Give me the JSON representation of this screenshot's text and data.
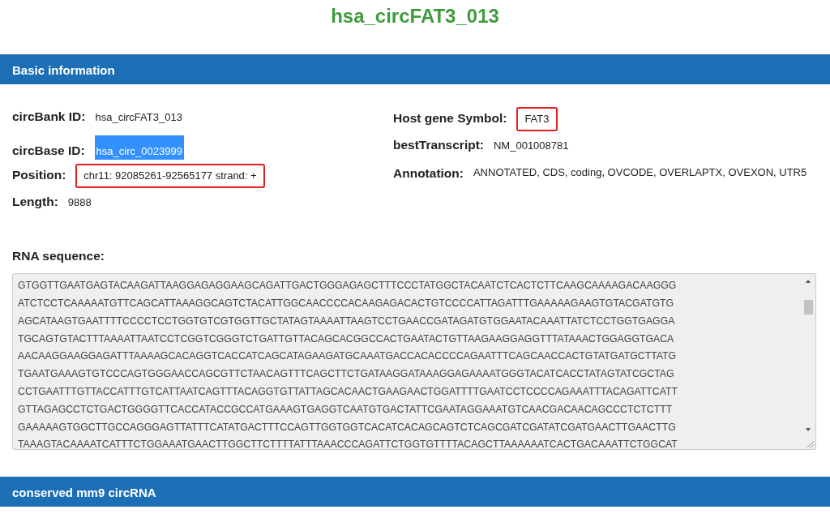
{
  "title": "hsa_circFAT3_013",
  "sections": [
    {
      "heading": "Basic information"
    },
    {
      "heading": "conserved mm9 circRNA"
    }
  ],
  "left_fields": [
    {
      "label": "circBank ID:",
      "value": "hsa_circFAT3_013",
      "highlighted": false,
      "outlined": false
    },
    {
      "label": "circBase ID:",
      "value": "hsa_circ_0023999",
      "highlighted": true,
      "outlined": false
    },
    {
      "label": "Position:",
      "value": "chr11: 92085261-92565177 strand: +",
      "highlighted": false,
      "outlined": true
    },
    {
      "label": "Length:",
      "value": "9888",
      "highlighted": false,
      "outlined": false
    }
  ],
  "right_fields": [
    {
      "label": "Host gene Symbol:",
      "value": "FAT3",
      "highlighted": false,
      "outlined": true
    },
    {
      "label": "bestTranscript:",
      "value": "NM_001008781",
      "highlighted": false,
      "outlined": false
    },
    {
      "label": "Annotation:",
      "value": "ANNOTATED, CDS, coding, OVCODE, OVERLAPTX, OVEXON, UTR5",
      "highlighted": false,
      "outlined": false
    }
  ],
  "sequence": {
    "label": "RNA sequence:",
    "lines": [
      "GTGGTTGAATGAGTACAAGATTAAGGAGAGGAAGCAGATTGACTGGGAGAGCTTTCCCTATGGCTACAATCTCACTCTTCAAGCAAAAGACAAGGG",
      "ATCTCCTCAAAAATGTTCAGCATTAAAGGCAGTCTACATTGGCAACCCCACAAGAGACACTGTCCCCATTAGATTTGAAAAAGAAGTGTACGATGTG",
      "AGCATAAGTGAATTTTCCCCTCCTGGTGTCGTGGTTGCTATAGTAAAATTAAGTCCTGAACCGATAGATGTGGAATACAAATTATCTCCTGGTGAGGA",
      "TGCAGTGTACTTTAAAATTAATCCTCGGTCGGGTCTGATTGTTACAGCACGGCCACTGAATACTGTTAAGAAGGAGGTTTATAAACTGGAGGTGACA",
      "AACAAGGAAGGAGATTTAAAAGCACAGGTCACCATCAGCATAGAAGATGCAAATGACCACACCCCAGAATTTCAGCAACCACTGTATGATGCTTATG",
      "TGAATGAAAGTGTCCCAGTGGGAACCAGCGTTCTAACAGTTTCAGCTTCTGATAAGGATAAAGGAGAAAATGGGTACATCACCTATAGTATCGCTAG",
      "CCTGAATTTGTTACCATTTGTCATTAATCAGTTTACAGGTGTTATTAGCACAACTGAAGAACTGGATTTTGAATCCTCCCCAGAAATTTACAGATTCATT",
      "GTTAGAGCCTCTGACTGGGGTTCACCATACCGCCATGAAAGTGAGGTCAATGTGACTATTCGAATAGGAAATGTCAACGACAACAGCCCTCTCTTT",
      "GAAAAAGTGGCTTGCCAGGGAGTTATTTCATATGACTTTCCAGTTGGTGGTCACATCACAGCAGTCTCAGCGATCGATATCGATGAACTTGAACTTG",
      "TAAAGTACAAAATCATTTCTGGAAATGAACTTGGCTTCTTTTATTTAAACCCAGATTCTGGTGTTTTACAGCTTAAAAAATCACTGACAAATTCTGGCAT"
    ]
  }
}
